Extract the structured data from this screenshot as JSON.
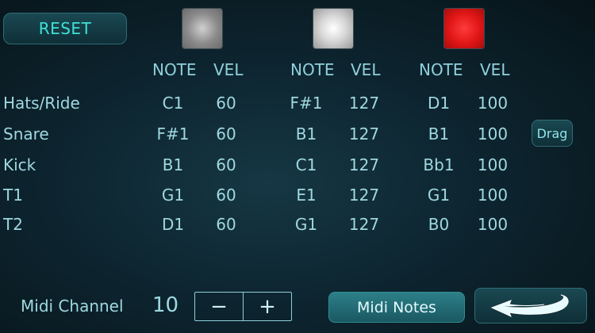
{
  "reset_label": "RESET",
  "pads": [
    {
      "name": "gray",
      "color": "#9a9a9a"
    },
    {
      "name": "white",
      "color": "#e6e6e6"
    },
    {
      "name": "red",
      "color": "#ee1f1f"
    }
  ],
  "headers": {
    "note": "NOTE",
    "vel": "VEL"
  },
  "rows": [
    {
      "label": "Hats/Ride",
      "cols": [
        {
          "note": "C1",
          "vel": "60"
        },
        {
          "note": "F#1",
          "vel": "127"
        },
        {
          "note": "D1",
          "vel": "100"
        }
      ]
    },
    {
      "label": "Snare",
      "cols": [
        {
          "note": "F#1",
          "vel": "60"
        },
        {
          "note": "B1",
          "vel": "127"
        },
        {
          "note": "B1",
          "vel": "100"
        }
      ]
    },
    {
      "label": "Kick",
      "cols": [
        {
          "note": "B1",
          "vel": "60"
        },
        {
          "note": "C1",
          "vel": "127"
        },
        {
          "note": "Bb1",
          "vel": "100"
        }
      ]
    },
    {
      "label": "T1",
      "cols": [
        {
          "note": "G1",
          "vel": "60"
        },
        {
          "note": "E1",
          "vel": "127"
        },
        {
          "note": "G1",
          "vel": "100"
        }
      ]
    },
    {
      "label": "T2",
      "cols": [
        {
          "note": "D1",
          "vel": "60"
        },
        {
          "note": "G1",
          "vel": "127"
        },
        {
          "note": "B0",
          "vel": "100"
        }
      ]
    }
  ],
  "drag_label": "Drag",
  "midi_channel": {
    "label": "Midi Channel",
    "value": "10",
    "minus": "−",
    "plus": "+"
  },
  "midi_notes_label": "Midi Notes",
  "back_icon": "back-arrow-icon",
  "colors": {
    "accent": "#3fe0d6",
    "text": "#9fd8e0",
    "button": "#2d7f88"
  }
}
